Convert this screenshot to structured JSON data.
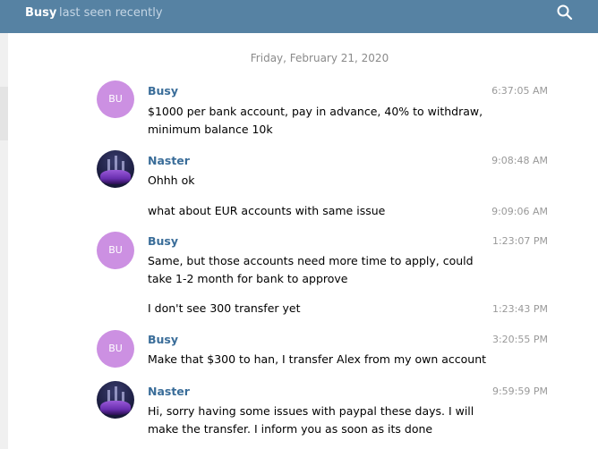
{
  "header": {
    "name": "Busy",
    "status": "last seen recently",
    "search_icon": "search-icon"
  },
  "chat": {
    "date": "Friday, February 21, 2020",
    "avatar_initials": "BU",
    "messages": [
      {
        "author": "Busy",
        "time": "6:37:05 AM",
        "text": "$1000 per bank account, pay in advance, 40% to withdraw, minimum balance 10k"
      },
      {
        "author": "Naster",
        "time": "9:08:48 AM",
        "text": "Ohhh ok"
      },
      {
        "author": "",
        "time": "9:09:06 AM",
        "text": "what about EUR accounts with same issue"
      },
      {
        "author": "Busy",
        "time": "1:23:07 PM",
        "text": "Same, but those accounts need more time to apply, could take 1-2 month for bank to approve"
      },
      {
        "author": "",
        "time": "1:23:43 PM",
        "text": "I don't see 300 transfer yet"
      },
      {
        "author": "Busy",
        "time": "3:20:55 PM",
        "text": "Make that $300 to han, I transfer Alex from my own account"
      },
      {
        "author": "Naster",
        "time": "9:59:59 PM",
        "text": "Hi, sorry having some issues with paypal these days. I will make the transfer. I inform you as soon as its done"
      }
    ]
  }
}
